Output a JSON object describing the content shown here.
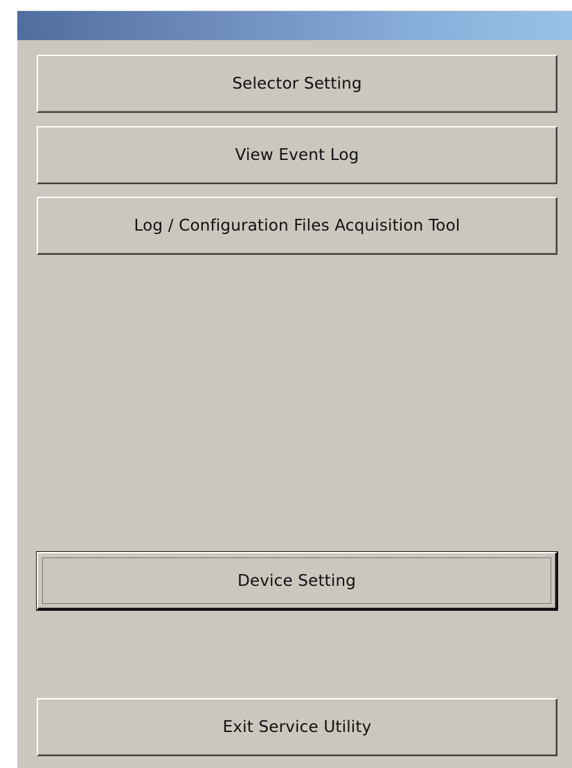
{
  "window": {
    "title": ""
  },
  "menu": {
    "selector_setting": "Selector Setting",
    "view_event_log": "View Event Log",
    "log_config_tool": "Log / Configuration Files Acquisition Tool",
    "device_setting": "Device Setting",
    "exit_service_utility": "Exit Service Utility"
  },
  "colors": {
    "panel_background": "#cbc7bf",
    "title_gradient_start": "#4f6d9f",
    "title_gradient_end": "#99c1e6"
  }
}
